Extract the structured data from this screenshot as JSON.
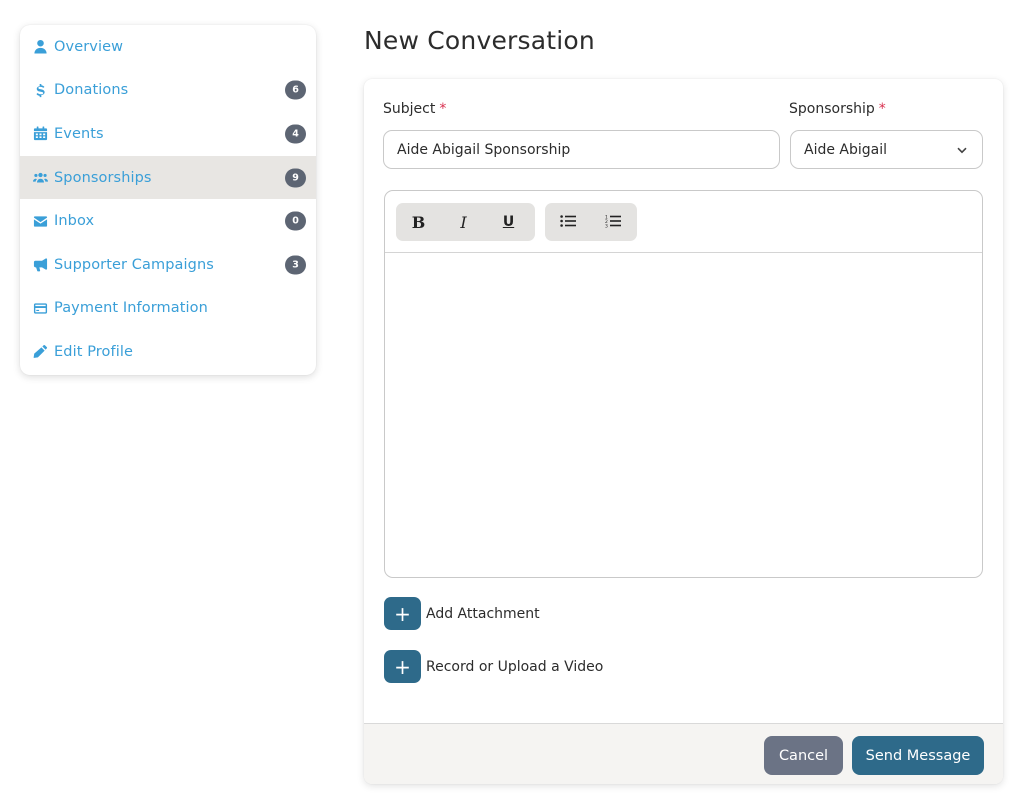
{
  "sidebar": {
    "items": [
      {
        "label": "Overview",
        "icon": "user-icon",
        "badge": null,
        "active": false
      },
      {
        "label": "Donations",
        "icon": "dollar-icon",
        "badge": "6",
        "active": false
      },
      {
        "label": "Events",
        "icon": "calendar-icon",
        "badge": "4",
        "active": false
      },
      {
        "label": "Sponsorships",
        "icon": "users-icon",
        "badge": "9",
        "active": true
      },
      {
        "label": "Inbox",
        "icon": "envelope-icon",
        "badge": "0",
        "active": false
      },
      {
        "label": "Supporter Campaigns",
        "icon": "megaphone-icon",
        "badge": "3",
        "active": false
      },
      {
        "label": "Payment Information",
        "icon": "credit-card-icon",
        "badge": null,
        "active": false
      },
      {
        "label": "Edit Profile",
        "icon": "pencil-icon",
        "badge": null,
        "active": false
      }
    ]
  },
  "page": {
    "title": "New Conversation"
  },
  "form": {
    "subject_label": "Subject",
    "required_mark": "*",
    "subject_value": "Aide Abigail Sponsorship",
    "sponsorship_label": "Sponsorship",
    "sponsorship_value": "Aide Abigail",
    "toolbar": {
      "bold": "B",
      "italic": "I",
      "underline": "U"
    },
    "add_attachment_label": "Add Attachment",
    "record_video_label": "Record or Upload a Video",
    "plus_symbol": "+"
  },
  "footer": {
    "cancel_label": "Cancel",
    "send_label": "Send Message"
  },
  "colors": {
    "link": "#3a9fd8",
    "badge": "#5d6573",
    "primary": "#2e6a8a",
    "cancel": "#6b7385",
    "required": "#d9304f"
  }
}
